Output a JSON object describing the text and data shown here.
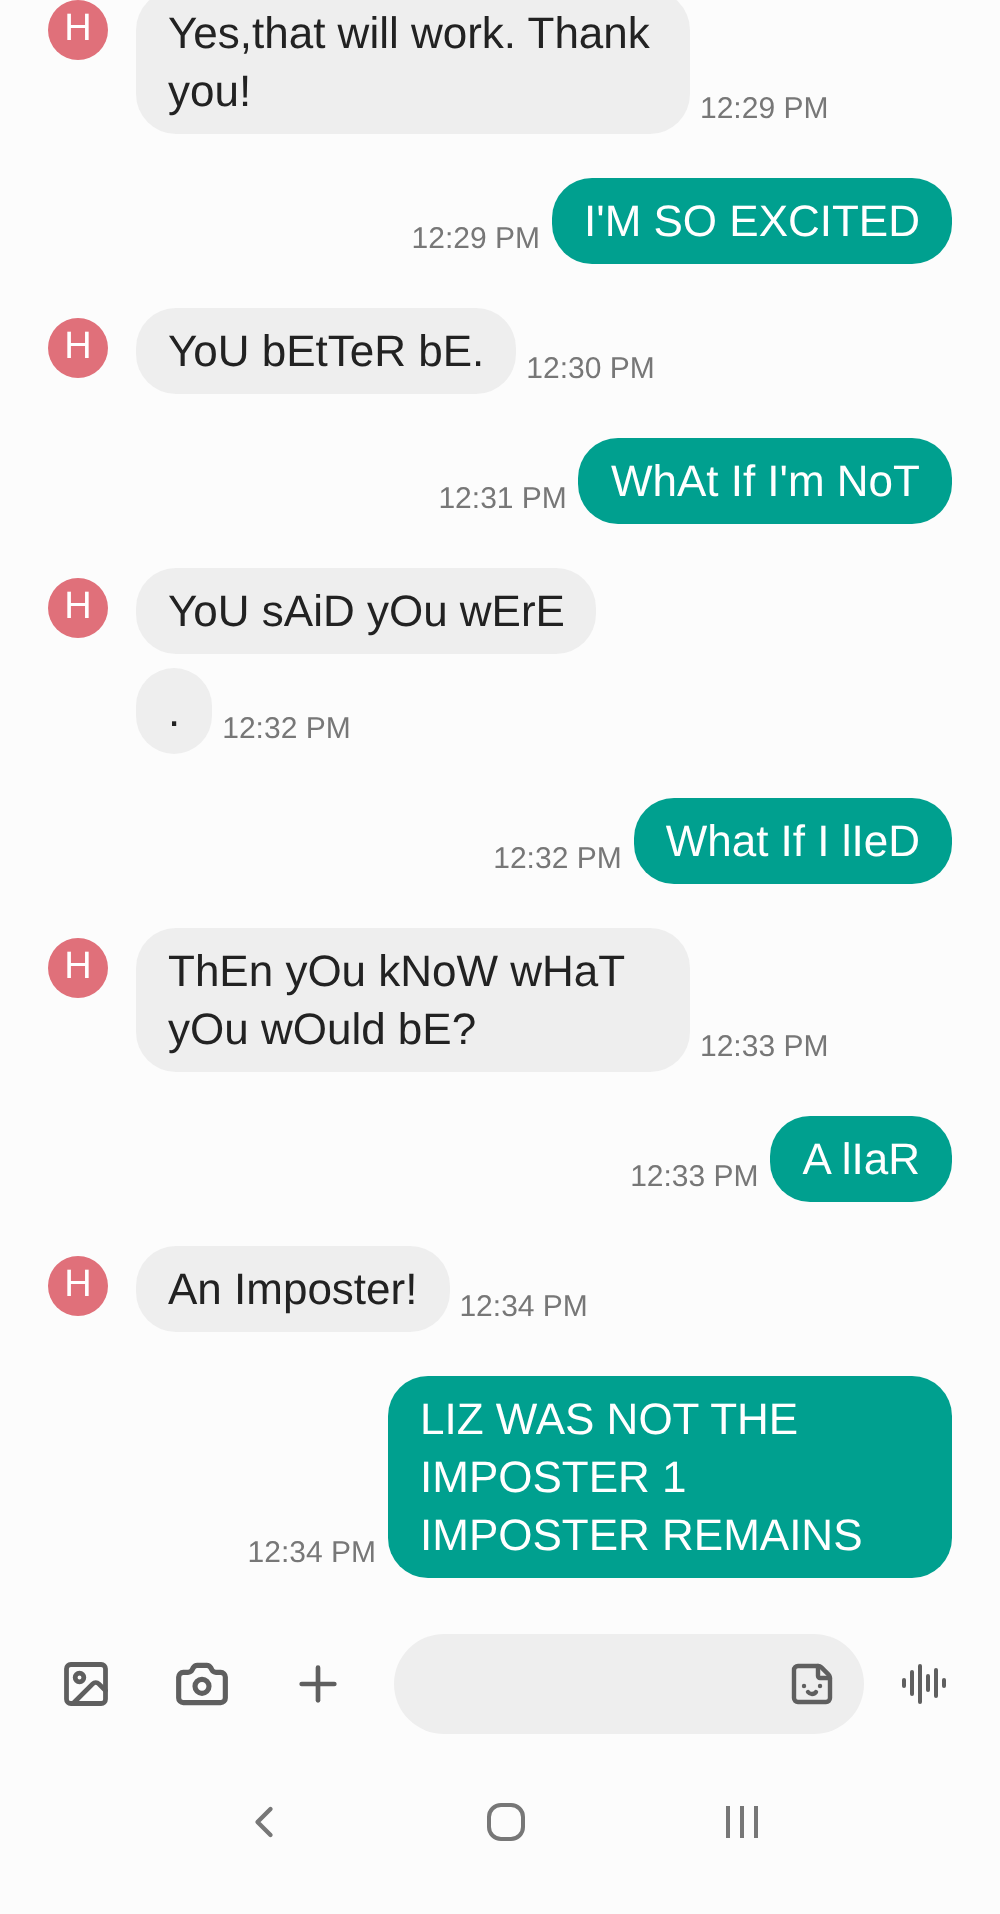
{
  "messages": [
    {
      "kind": "received",
      "avatar": "H",
      "text": "Yes,that will work. Thank you!",
      "time": "12:29 PM"
    },
    {
      "kind": "sent",
      "text": "I'M SO EXCITED",
      "time": "12:29 PM"
    },
    {
      "kind": "received",
      "avatar": "H",
      "text": "YoU bEtTeR bE.",
      "time": "12:30 PM"
    },
    {
      "kind": "sent",
      "text": "WhAt If I'm NoT",
      "time": "12:31 PM"
    },
    {
      "kind": "received",
      "avatar": "H",
      "text": "YoU sAiD yOu wErE"
    },
    {
      "kind": "received",
      "text": ".",
      "time": "12:32 PM"
    },
    {
      "kind": "sent",
      "text": "What If I lIeD",
      "time": "12:32 PM"
    },
    {
      "kind": "received",
      "avatar": "H",
      "text": "ThEn yOu kNoW wHaT yOu wOuld bE?",
      "time": "12:33 PM"
    },
    {
      "kind": "sent",
      "text": "A lIaR",
      "time": "12:33 PM"
    },
    {
      "kind": "received",
      "avatar": "H",
      "text": "An Imposter!",
      "time": "12:34 PM"
    },
    {
      "kind": "sent",
      "text": "LIZ WAS NOT THE IMPOSTER 1 IMPOSTER REMAINS",
      "time": "12:34 PM"
    }
  ]
}
